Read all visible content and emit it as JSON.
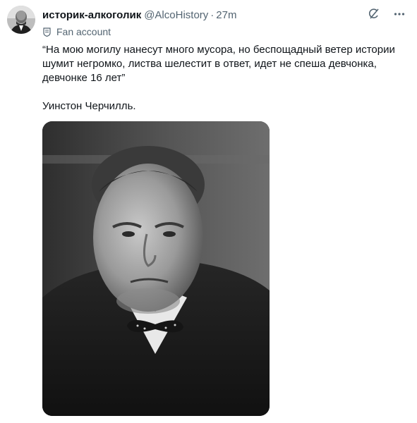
{
  "post": {
    "display_name": "историк-алкоголик",
    "handle": "@AlcoHistory",
    "separator": "·",
    "time": "27m",
    "label": "Fan account",
    "quote": "“На мою могилу нанесут много мусора, но беспощадный ветер истории шумит негромко, листва шелестит в ответ, идет не спеша девчонка, девчонке 16 лет”",
    "author": "Уинстон Черчилль."
  },
  "icons": {
    "avatar": "portrait-avatar",
    "grok": "grok-icon",
    "more": "more-options-icon",
    "label": "fan-account-badge-icon"
  },
  "colors": {
    "text_primary": "#0f1419",
    "text_secondary": "#536471",
    "background": "#ffffff"
  }
}
